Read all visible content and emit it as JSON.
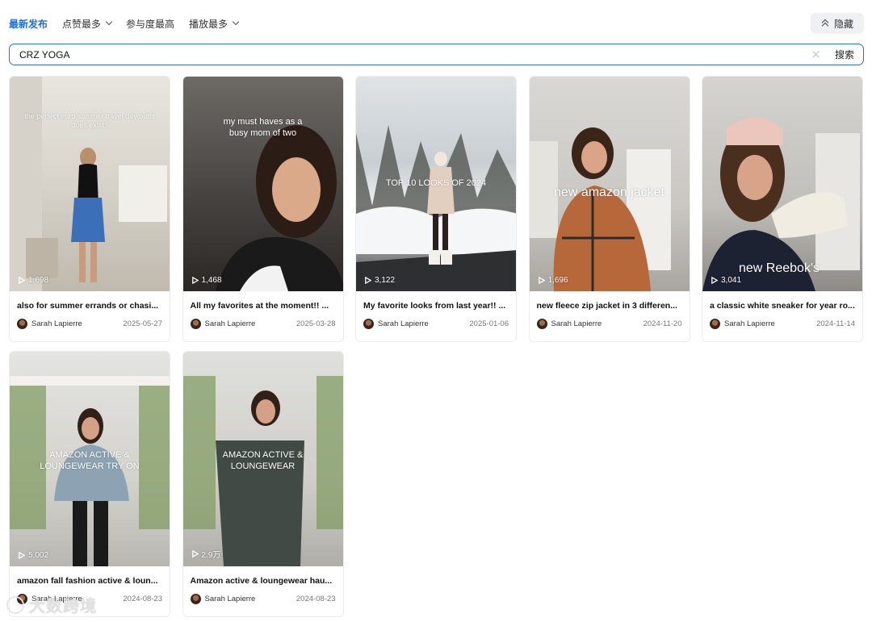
{
  "sort_tabs": [
    {
      "label": "最新发布",
      "active": true,
      "dropdown": false
    },
    {
      "label": "点赞最多",
      "active": false,
      "dropdown": true
    },
    {
      "label": "参与度最高",
      "active": false,
      "dropdown": false
    },
    {
      "label": "播放最多",
      "active": false,
      "dropdown": true
    }
  ],
  "hide_button": {
    "label": "隐藏"
  },
  "search": {
    "value": "CRZ YOGA",
    "button_label": "搜索"
  },
  "colors": {
    "accent": "#1f6fe0",
    "search_border": "#2e6be6"
  },
  "videos": [
    {
      "caption": "the perfect euro summer travel day outfit does exist!!",
      "views": "1,698",
      "title": "also for summer errands or chasi...",
      "author": "Sarah Lapierre",
      "date": "2025-05-27"
    },
    {
      "caption": "my must haves as a busy mom of two",
      "views": "1,468",
      "title": "All my favorites at the moment!! ...",
      "author": "Sarah Lapierre",
      "date": "2025-03-28"
    },
    {
      "caption": "TOP 10 LOOKS OF 2024",
      "views": "3,122",
      "title": "My favorite looks from last year!! ...",
      "author": "Sarah Lapierre",
      "date": "2025-01-06"
    },
    {
      "caption": "new amazon jacket",
      "views": "1,696",
      "title": "new fleece zip jacket in 3 differen...",
      "author": "Sarah Lapierre",
      "date": "2024-11-20"
    },
    {
      "caption": "new Reebok's",
      "views": "3,041",
      "title": "a classic white sneaker for year ro...",
      "author": "Sarah Lapierre",
      "date": "2024-11-14"
    },
    {
      "caption": "AMAZON ACTIVE & LOUNGEWEAR TRY ON",
      "views": "5,002",
      "title": "amazon fall fashion active & loun...",
      "author": "Sarah Lapierre",
      "date": "2024-08-23"
    },
    {
      "caption": "AMAZON ACTIVE & LOUNGEWEAR",
      "views": "2.9万",
      "title": "Amazon active & loungewear hau...",
      "author": "Sarah Lapierre",
      "date": "2024-08-23"
    }
  ],
  "watermark": "大数跨境"
}
